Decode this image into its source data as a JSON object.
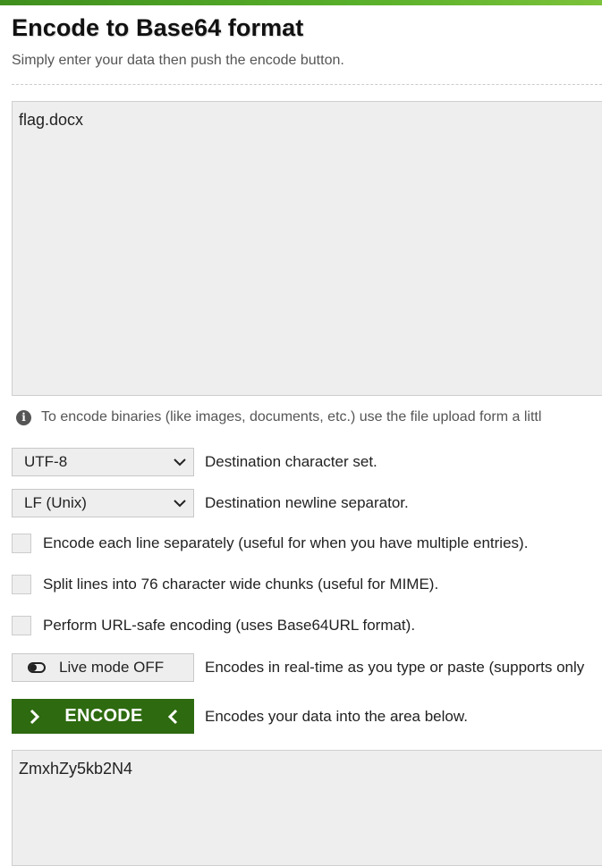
{
  "header": {
    "title": "Encode to Base64 format",
    "subtitle": "Simply enter your data then push the encode button."
  },
  "input": {
    "value": "flag.docx"
  },
  "info": {
    "icon": "info-icon",
    "text": "To encode binaries (like images, documents, etc.) use the file upload form a littl"
  },
  "options": {
    "charset": {
      "selected": "UTF-8",
      "label": "Destination character set."
    },
    "newline": {
      "selected": "LF (Unix)",
      "label": "Destination newline separator."
    },
    "checkboxes": [
      {
        "label": "Encode each line separately (useful for when you have multiple entries).",
        "checked": false
      },
      {
        "label": "Split lines into 76 character wide chunks (useful for MIME).",
        "checked": false
      },
      {
        "label": "Perform URL-safe encoding (uses Base64URL format).",
        "checked": false
      }
    ],
    "live_mode": {
      "button_label": "Live mode OFF",
      "description": "Encodes in real-time as you type or paste (supports only"
    }
  },
  "encode": {
    "button_label": "ENCODE",
    "description": "Encodes your data into the area below."
  },
  "output": {
    "value": "ZmxhZy5kb2N4"
  },
  "colors": {
    "accent_green": "#2e6a10",
    "top_bar": "#59b02a",
    "field_bg": "#eeeeee"
  }
}
